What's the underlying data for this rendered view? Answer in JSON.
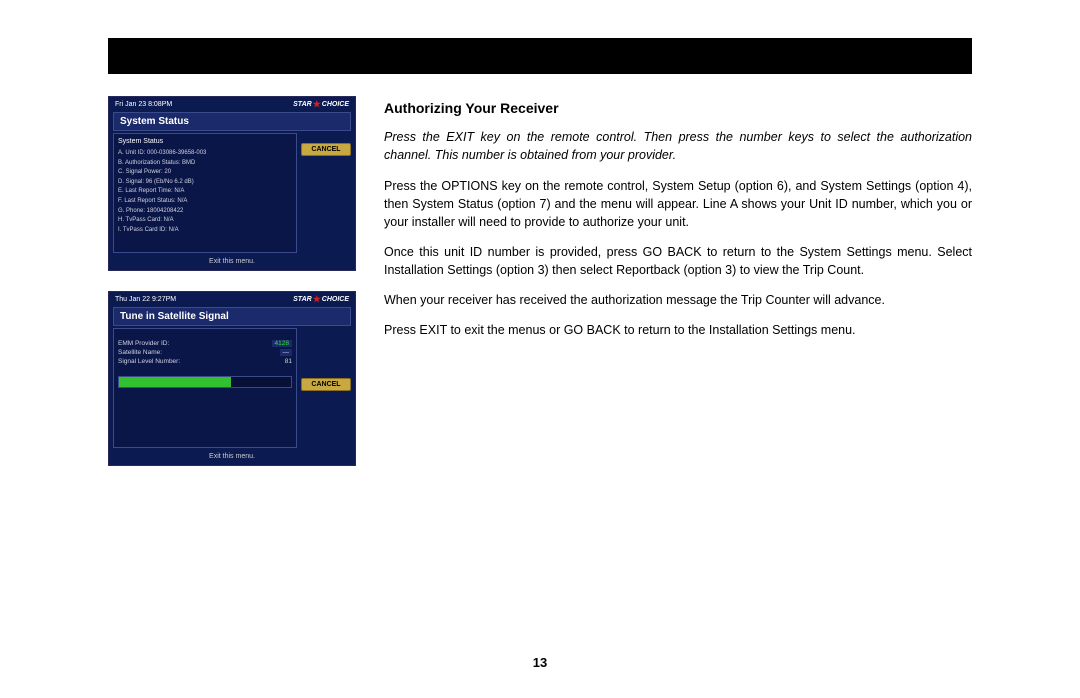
{
  "page_number": "13",
  "heading": "Authorizing Your Receiver",
  "paragraphs": {
    "p1": "Press the EXIT key on the remote control. Then press the number keys to select the authorization channel. This number is obtained from your provider.",
    "p2": "Press the OPTIONS key on the remote control, System Setup (option 6), and System Settings (option 4), then System Status (option 7) and the menu will appear. Line A shows your Unit ID number, which you or your installer will need to provide to authorize your unit.",
    "p3": "Once this unit ID number is provided, press GO BACK to return to the System Settings menu. Select Installation Settings (option 3) then select Reportback (option 3) to view the Trip Count.",
    "p4": "When your receiver has received the authorization message the Trip Counter will advance.",
    "p5": "Press EXIT to exit the menus or GO BACK to return to the Installation Settings menu."
  },
  "logo_text_left": "STAR",
  "logo_text_right": "CHOICE",
  "screenshot1": {
    "datetime": "Fri Jan 23 8:08PM",
    "title": "System Status",
    "panel_header": "System Status",
    "lines": {
      "a": "A. Unit ID:   000-03086-39658-003",
      "b": "B. Authorization Status:   BMD",
      "c": "C. Signal Power:   20",
      "d": "D. Signal:   96  (Eb/No 6.2 dB)",
      "e": "E. Last Report Time:   N/A",
      "f": "F. Last Report Status:   N/A",
      "g": "G. Phone:   18004208422",
      "h": "H. TvPass Card:   N/A",
      "i": "I. TvPass Card ID:   N/A"
    },
    "cancel": "CANCEL",
    "footer": "Exit this menu."
  },
  "screenshot2": {
    "datetime": "Thu Jan 22 9:27PM",
    "title": "Tune in Satellite Signal",
    "rows": {
      "r1_label": "EMM Provider ID:",
      "r1_value": "4128",
      "r2_label": "Satellite Name:",
      "r2_value": "—",
      "r3_label": "Signal Level Number:",
      "r3_value": "81"
    },
    "cancel": "CANCEL",
    "footer": "Exit this menu."
  }
}
